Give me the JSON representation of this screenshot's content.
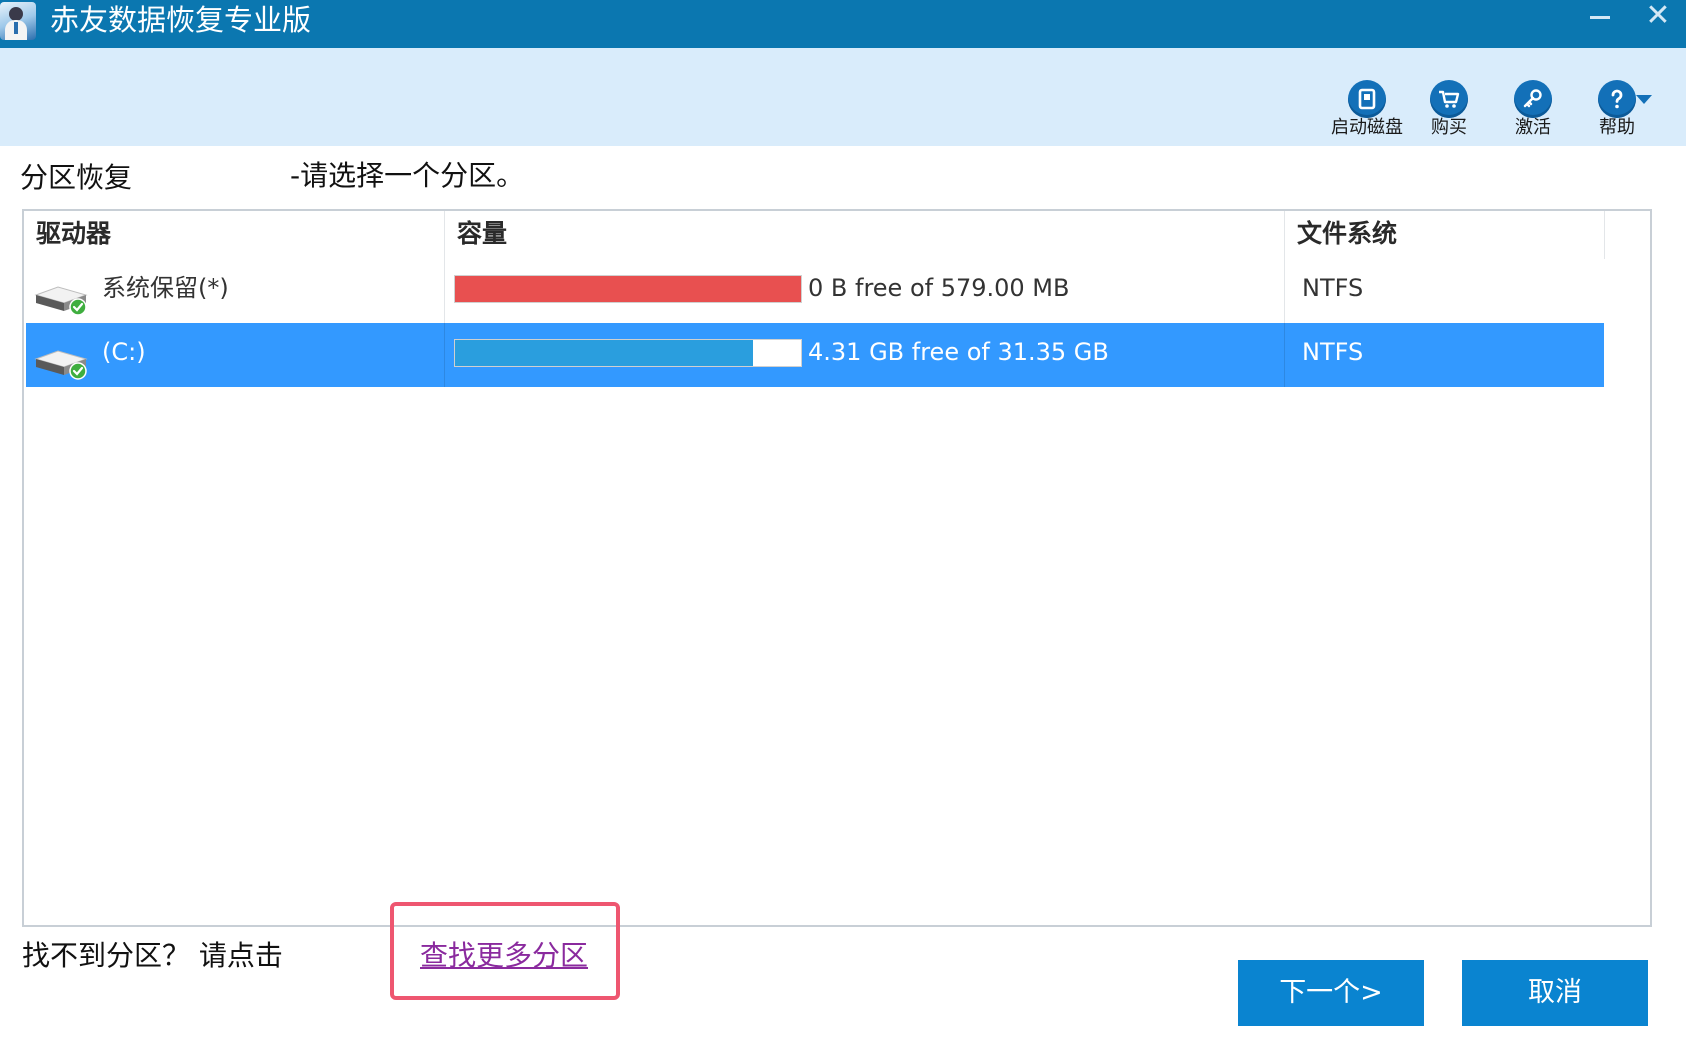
{
  "window": {
    "title": "赤友数据恢复专业版",
    "minimize_glyph": "—",
    "close_glyph": "✕"
  },
  "toolbar": {
    "items": [
      {
        "label": "启动磁盘",
        "icon": "boot-disk-icon"
      },
      {
        "label": "购买",
        "icon": "cart-icon"
      },
      {
        "label": "激活",
        "icon": "key-icon"
      },
      {
        "label": "帮助",
        "icon": "help-icon"
      }
    ]
  },
  "header": {
    "title": "分区恢复",
    "hint": "-请选择一个分区。"
  },
  "table": {
    "columns": [
      "驱动器",
      "容量",
      "文件系统"
    ],
    "rows": [
      {
        "drive": "系统保留(*)",
        "capacity": "0 B free of 579.00 MB",
        "used_fraction": 1.0,
        "bar_color": "#e85050",
        "filesystem": "NTFS",
        "selected": false
      },
      {
        "drive": "(C:)",
        "capacity": "4.31 GB free of 31.35 GB",
        "used_fraction": 0.86,
        "bar_color": "#2a9ede",
        "filesystem": "NTFS",
        "selected": true
      }
    ]
  },
  "footer": {
    "cant_find": "找不到分区？ 请点击",
    "find_more": "查找更多分区",
    "next": "下一个>",
    "cancel": "取消"
  },
  "colors": {
    "titlebar": "#0b77b0",
    "toolbar_bg": "#d9ecfb",
    "selected_row": "#3399ff",
    "button": "#0a84d0",
    "highlight_box": "#ee5670",
    "link": "#8a2a9e"
  }
}
